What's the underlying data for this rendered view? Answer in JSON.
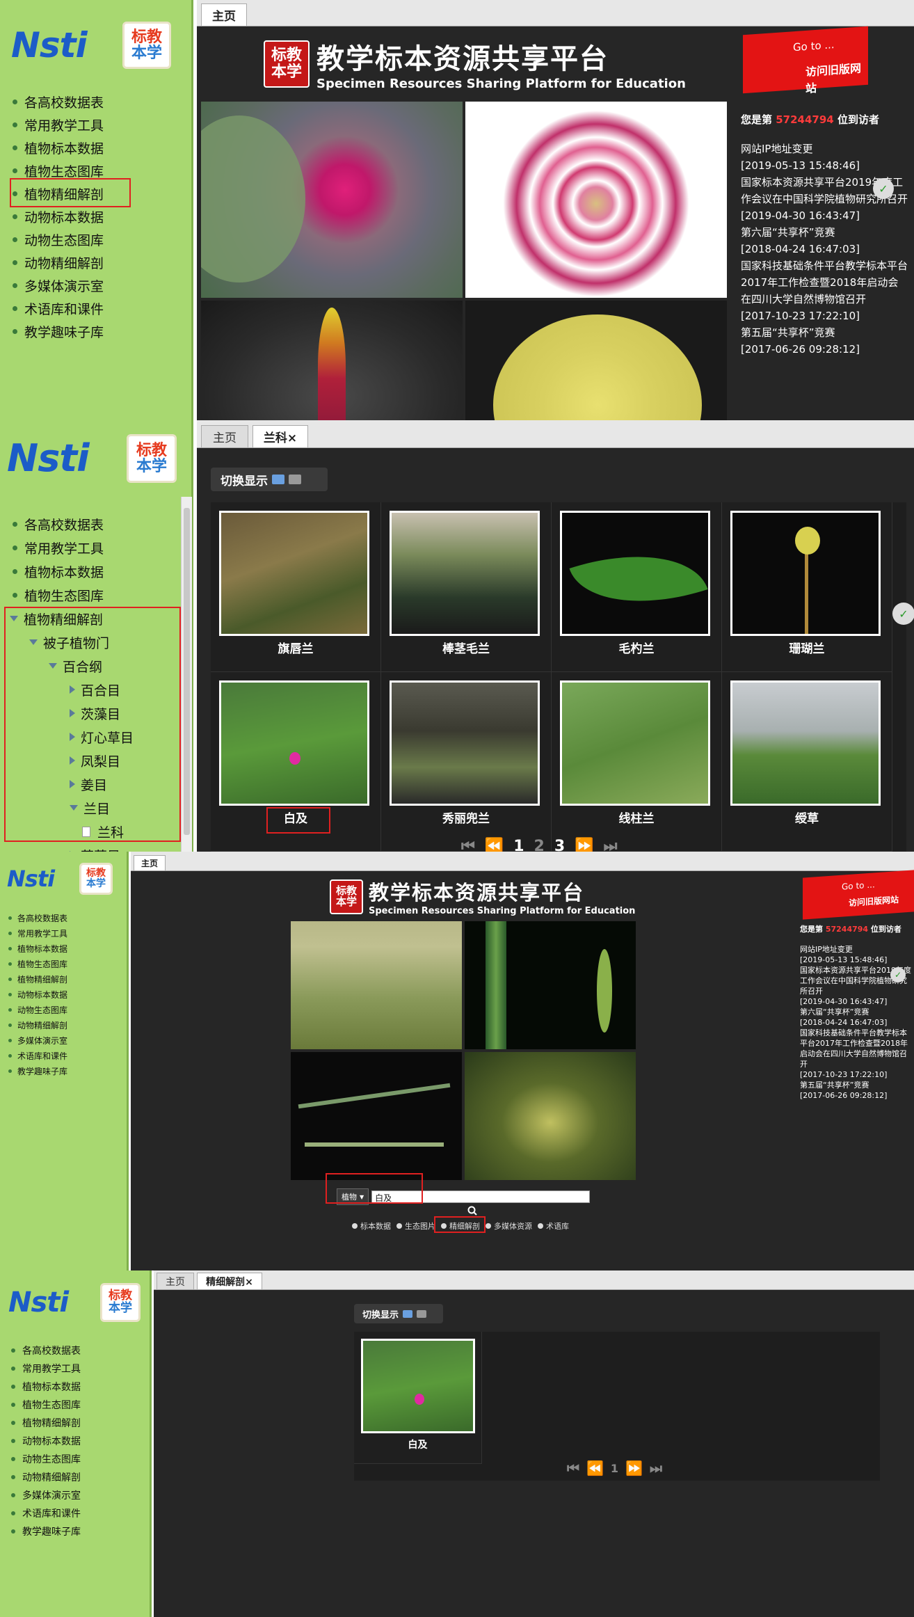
{
  "nav": [
    "各高校数据表",
    "常用教学工具",
    "植物标本数据",
    "植物生态图库",
    "植物精细解剖",
    "动物标本数据",
    "动物生态图库",
    "动物精细解剖",
    "多媒体演示室",
    "术语库和课件",
    "教学趣味子库"
  ],
  "logo": {
    "text": "Nsti",
    "badge_line1": "标教",
    "badge_line2": "本学"
  },
  "header": {
    "seal1": "标教",
    "seal2": "本学",
    "title_zh": "教学标本资源共享平台",
    "title_en": "Specimen Resources Sharing Platform for Education"
  },
  "goto": {
    "line1": "Go to ...",
    "line2": "访问旧版网站"
  },
  "news": {
    "visit_prefix": "您是第",
    "visit_count": "57244794",
    "visit_suffix": "位到访者",
    "items": [
      {
        "title": "网站IP地址变更",
        "date": "[2019-05-13 15:48:46]"
      },
      {
        "title": "国家标本资源共享平台2019年度工作会议在中国科学院植物研究所召开",
        "date": "[2019-04-30 16:43:47]"
      },
      {
        "title": "第六届“共享杯”竞赛",
        "date": "[2018-04-24 16:47:03]"
      },
      {
        "title": "国家科技基础条件平台教学标本平台2017年工作检查暨2018年启动会在四川大学自然博物馆召开",
        "date": "[2017-10-23 17:22:10]"
      },
      {
        "title": "第五届“共享杯”竞赛",
        "date": "[2017-06-26 09:28:12]"
      }
    ]
  },
  "tabs": {
    "home": "主页",
    "lanke": "兰科×",
    "jingxi": "精细解剖×"
  },
  "tree": {
    "root": "植物精细解剖",
    "l1": "被子植物门",
    "l2": "百合纲",
    "orders": [
      "百合目",
      "茨藻目",
      "灯心草目",
      "凤梨目",
      "姜目",
      "兰目"
    ],
    "leaf": "兰科",
    "next": "莎草目"
  },
  "toggle_label": "切换显示",
  "gallery": [
    "旗唇兰",
    "棒茎毛兰",
    "毛杓兰",
    "珊瑚兰",
    "白及",
    "秀丽兜兰",
    "线柱兰",
    "绶草"
  ],
  "pager": {
    "pages": [
      "1",
      "2",
      "3"
    ],
    "first": "⏮",
    "prev": "⏪",
    "next": "⏩",
    "last": "⏭"
  },
  "search": {
    "select": "植物",
    "value": "白及",
    "options": [
      "标本数据",
      "生态图片",
      "精细解剖",
      "多媒体资源",
      "术语库"
    ]
  },
  "result": {
    "name": "白及",
    "page": "1"
  },
  "colors": {
    "sidebar": "#a8d870",
    "dark": "#262626",
    "accent": "#e02020",
    "news_count": "#ff3b3b"
  }
}
